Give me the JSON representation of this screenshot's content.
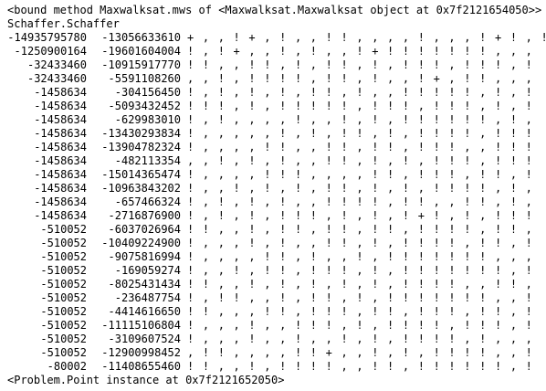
{
  "header": {
    "line1": "<bound method Maxwalksat.mws of <Maxwalksat.Maxwalksat object at 0x7f2121654050>>",
    "line2": "Schaffer.Schaffer"
  },
  "rows": [
    {
      "a": "-14935795780",
      "b": "-13056633610",
      "marks": "+ , , ! + , ! , , ! ! , , , , ! , , , ! + ! , !"
    },
    {
      "a": "-1250900164",
      "b": "-19601604004",
      "marks": "! , ! + , , ! , ! , , ! + ! ! ! ! ! ! ! , , ,"
    },
    {
      "a": "-32433460",
      "b": "-10915917770",
      "marks": "! ! , , ! ! , ! , ! ! , ! , ! ! ! , ! ! ! , !"
    },
    {
      "a": "-32433460",
      "b": "-5591108260",
      "marks": ", , ! , ! ! ! ! , ! ! , ! , , ! + , ! ! , , ,"
    },
    {
      "a": "-1458634",
      "b": "-304156450",
      "marks": "! , ! , ! , ! , ! ! , ! , , ! ! ! ! ! , ! , !"
    },
    {
      "a": "-1458634",
      "b": "-5093432452",
      "marks": "! ! ! , ! , ! ! ! ! ! , ! ! ! , ! ! ! , ! , !"
    },
    {
      "a": "-1458634",
      "b": "-629983010",
      "marks": "! , ! , , , , ! , , ! , ! , ! ! ! ! ! ! , ! ,"
    },
    {
      "a": "-1458634",
      "b": "-13430293834",
      "marks": "! , , , , , ! , ! , ! ! , ! , ! ! ! ! , ! ! !"
    },
    {
      "a": "-1458634",
      "b": "-13904782324",
      "marks": "! , , , , ! ! , , ! ! , ! ! , ! ! ! , , ! ! !"
    },
    {
      "a": "-1458634",
      "b": "-482113354",
      "marks": ", , ! , ! , ! , , ! ! , ! , ! , ! ! ! , ! ! !"
    },
    {
      "a": "-1458634",
      "b": "-15014365474",
      "marks": "! , , , , ! ! ! , , , , ! ! , ! ! ! , ! ! , !"
    },
    {
      "a": "-1458634",
      "b": "-10963843202",
      "marks": "! , , ! , ! , ! , ! ! , ! , ! , ! ! ! ! , ! ,"
    },
    {
      "a": "-1458634",
      "b": "-657466324",
      "marks": "! , ! , ! , ! , , ! ! ! ! , ! ! , , ! ! , ! ,"
    },
    {
      "a": "-1458634",
      "b": "-2716876900",
      "marks": "! , ! , ! , ! ! ! , ! , ! , ! + ! , ! , ! ! !"
    },
    {
      "a": "-510052",
      "b": "-6037026964",
      "marks": "! ! , , ! , ! ! , ! ! , ! ! , ! ! ! ! , ! ! ,"
    },
    {
      "a": "-510052",
      "b": "-10409224900",
      "marks": "! , , , ! , ! , , ! ! , ! , ! ! ! ! , ! ! , !"
    },
    {
      "a": "-510052",
      "b": "-9075816994",
      "marks": "! , , , , ! ! , ! , , ! , ! ! ! ! ! ! ! , , ,"
    },
    {
      "a": "-510052",
      "b": "-169059274",
      "marks": "! , , ! , ! ! , ! ! ! , ! , ! ! ! ! ! ! ! , !"
    },
    {
      "a": "-510052",
      "b": "-8025431434",
      "marks": "! ! , , ! , ! , ! , ! , ! , ! ! ! ! , , ! ! ,"
    },
    {
      "a": "-510052",
      "b": "-236487754",
      "marks": "! , ! ! , , ! , ! ! , ! , ! ! ! ! ! ! ! , , !"
    },
    {
      "a": "-510052",
      "b": "-4414616650",
      "marks": "! ! , , , ! ! , ! ! ! , ! ! , ! ! ! , ! ! , !"
    },
    {
      "a": "-510052",
      "b": "-11115106804",
      "marks": "! , , , ! , , ! ! ! , ! , ! ! ! ! , ! ! ! , !"
    },
    {
      "a": "-510052",
      "b": "-3109607524",
      "marks": "! , , , ! , , ! , , ! , ! , ! ! ! ! , ! , , ,"
    },
    {
      "a": "-510052",
      "b": "-12900998452",
      "marks": ", ! ! , , , , ! ! + , , ! , ! , ! ! ! ! , , !"
    },
    {
      "a": "-80002",
      "b": "-11408655460",
      "marks": "! ! , , ! , ! ! ! ! , , ! ! , ! ! ! ! ! ! , !"
    }
  ],
  "footer": {
    "line": "<Problem.Point instance at 0x7f2121652050>"
  }
}
